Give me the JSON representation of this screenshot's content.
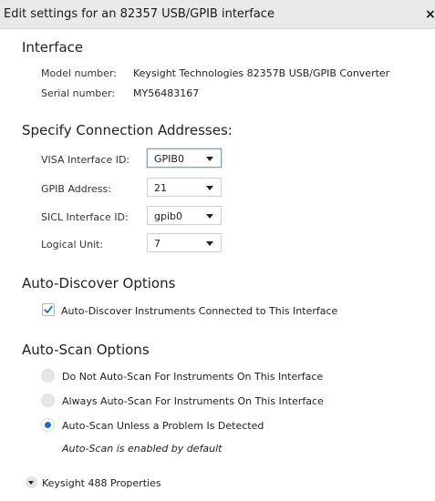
{
  "window": {
    "title": "Edit settings for an 82357 USB/GPIB interface",
    "close_glyph": "×"
  },
  "interface": {
    "heading": "Interface",
    "model_label": "Model number:",
    "model_value": "Keysight Technologies 82357B USB/GPIB Converter",
    "serial_label": "Serial number:",
    "serial_value": "MY56483167"
  },
  "connection": {
    "heading": "Specify Connection Addresses:",
    "fields": [
      {
        "label": "VISA Interface ID:",
        "value": "GPIB0"
      },
      {
        "label": "GPIB Address:",
        "value": "21"
      },
      {
        "label": "SICL Interface ID:",
        "value": "gpib0"
      },
      {
        "label": "Logical Unit:",
        "value": "7"
      }
    ]
  },
  "auto_discover": {
    "heading": "Auto-Discover Options",
    "checkbox_label": "Auto-Discover Instruments Connected to This Interface",
    "checked": true
  },
  "auto_scan": {
    "heading": "Auto-Scan Options",
    "options": [
      {
        "label": "Do Not Auto-Scan For Instruments On This Interface",
        "selected": false
      },
      {
        "label": "Always Auto-Scan For Instruments On This Interface",
        "selected": false
      },
      {
        "label": "Auto-Scan Unless a Problem Is Detected",
        "selected": true
      }
    ],
    "note": "Auto-Scan is enabled by default"
  },
  "properties": {
    "label": "Keysight 488 Properties"
  },
  "colors": {
    "accent": "#1f6fc4",
    "titlebar": "#e9e9e9"
  }
}
